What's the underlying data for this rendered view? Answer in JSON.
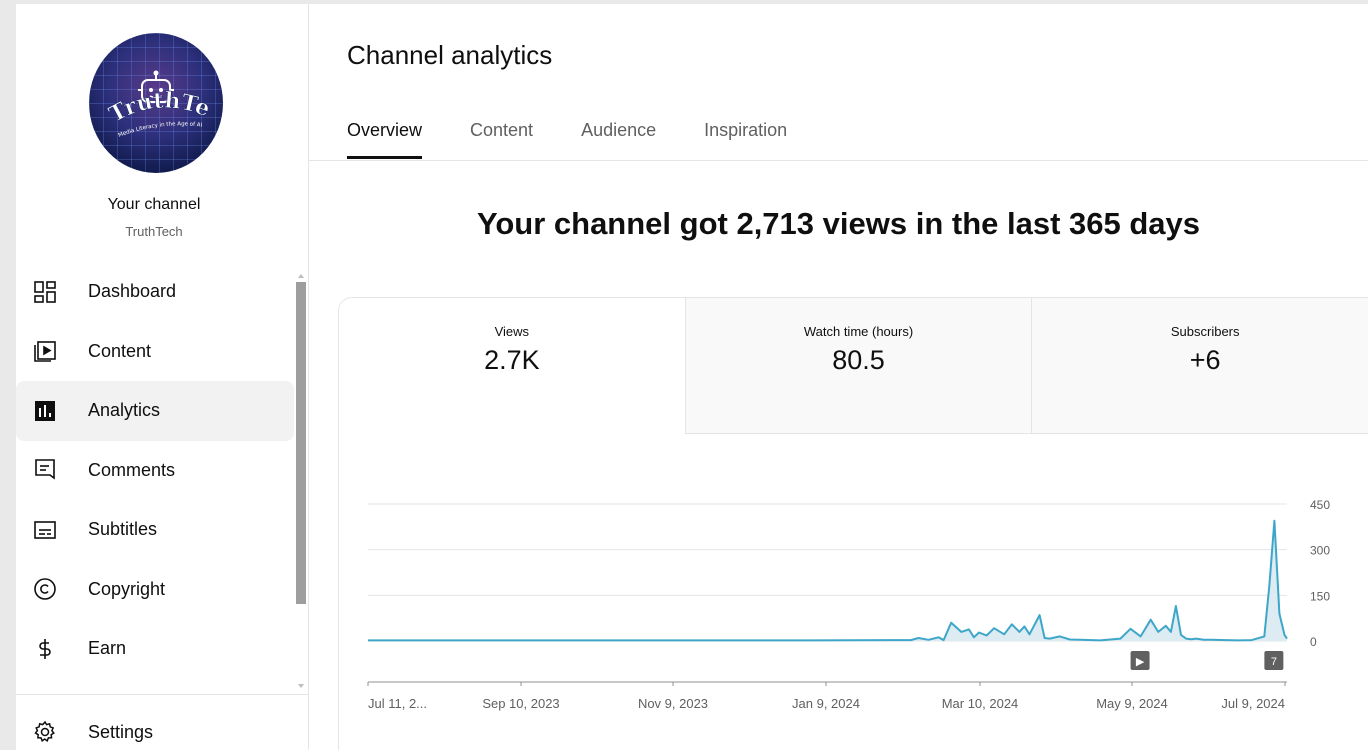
{
  "sidebar": {
    "channel_label": "Your channel",
    "channel_handle": "TruthTech",
    "avatar_text": "TruthTech",
    "avatar_subtext": "Media Literacy in the Age of AI",
    "items": [
      {
        "label": "Dashboard",
        "icon": "dashboard-icon"
      },
      {
        "label": "Content",
        "icon": "content-icon"
      },
      {
        "label": "Analytics",
        "icon": "analytics-icon",
        "active": true
      },
      {
        "label": "Comments",
        "icon": "comments-icon"
      },
      {
        "label": "Subtitles",
        "icon": "subtitles-icon"
      },
      {
        "label": "Copyright",
        "icon": "copyright-icon"
      },
      {
        "label": "Earn",
        "icon": "earn-icon"
      }
    ],
    "settings_label": "Settings"
  },
  "main": {
    "title": "Channel analytics",
    "tabs": [
      {
        "label": "Overview",
        "active": true
      },
      {
        "label": "Content"
      },
      {
        "label": "Audience"
      },
      {
        "label": "Inspiration"
      }
    ],
    "headline": "Your channel got 2,713 views in the last 365 days",
    "metrics": [
      {
        "name": "Views",
        "value": "2.7K"
      },
      {
        "name": "Watch time (hours)",
        "value": "80.5"
      },
      {
        "name": "Subscribers",
        "value": "+6"
      }
    ]
  },
  "colors": {
    "accent_line": "#3ea6c8",
    "accent_fill": "#dcecf2",
    "marker": "#606060"
  },
  "chart_data": {
    "type": "area",
    "x_tick_labels": [
      "Jul 11, 2...",
      "Sep 10, 2023",
      "Nov 9, 2023",
      "Jan 9, 2024",
      "Mar 10, 2024",
      "May 9, 2024",
      "Jul 9, 2024"
    ],
    "y_tick_labels": [
      "450",
      "300",
      "150",
      "0"
    ],
    "ylim": [
      0,
      450
    ],
    "grid": true,
    "x_days": [
      0,
      35,
      70,
      105,
      140,
      175,
      215,
      218,
      222,
      226,
      228,
      231,
      235,
      238,
      240,
      242,
      245,
      248,
      252,
      255,
      258,
      260,
      262,
      266,
      268,
      270,
      274,
      278,
      282,
      290,
      298,
      302,
      306,
      310,
      313,
      316,
      318,
      320,
      322,
      324,
      326,
      328,
      331,
      334,
      340,
      345,
      350,
      355,
      357,
      359,
      361,
      363,
      364
    ],
    "values": [
      2,
      2,
      2,
      2,
      2,
      2,
      3,
      10,
      4,
      12,
      3,
      60,
      30,
      38,
      12,
      28,
      18,
      42,
      22,
      55,
      30,
      48,
      22,
      85,
      10,
      8,
      15,
      5,
      4,
      2,
      8,
      40,
      15,
      70,
      30,
      50,
      30,
      115,
      20,
      8,
      6,
      8,
      4,
      4,
      3,
      2,
      3,
      15,
      180,
      395,
      90,
      20,
      8
    ],
    "markers": [
      {
        "x_day": 306,
        "label": "▶"
      },
      {
        "x_day": 359,
        "label": "7"
      }
    ]
  }
}
